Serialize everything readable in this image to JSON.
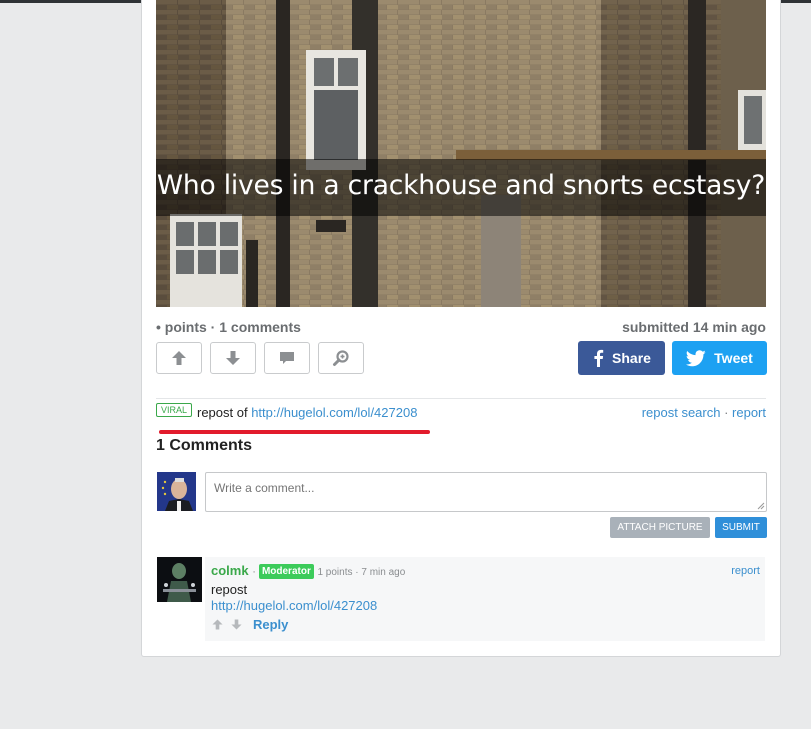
{
  "post": {
    "caption": "Who lives in a crackhouse and snorts ecstasy?",
    "meta_left": "• points · 1 comments",
    "meta_right": "submitted 14 min ago"
  },
  "share": {
    "facebook_label": "Share",
    "twitter_label": "Tweet"
  },
  "repost": {
    "badge": "VIRAL",
    "prefix": "repost of ",
    "link": "http://hugelol.com/lol/427208",
    "repost_search": "repost search",
    "separator": " · ",
    "report": "report"
  },
  "comments": {
    "heading": "1 Comments",
    "input_placeholder": "Write a comment...",
    "attach_label": "ATTACH PICTURE",
    "submit_label": "SUBMIT",
    "items": [
      {
        "username": "colmk",
        "role": "Moderator",
        "points": "1 points",
        "age": "7 min ago",
        "report": "report",
        "body": "repost",
        "link": "http://hugelol.com/lol/427208",
        "reply": "Reply"
      }
    ]
  },
  "colors": {
    "page_bg": "#e9eaeb",
    "link": "#3b8fce",
    "facebook": "#3b5998",
    "twitter": "#1da1f2",
    "moderator": "#3ccb5a",
    "highlight_underline": "#e21b2c"
  },
  "icons": [
    "upvote-arrow-icon",
    "downvote-arrow-icon",
    "comment-bubble-icon",
    "zoom-icon",
    "facebook-icon",
    "twitter-icon"
  ]
}
